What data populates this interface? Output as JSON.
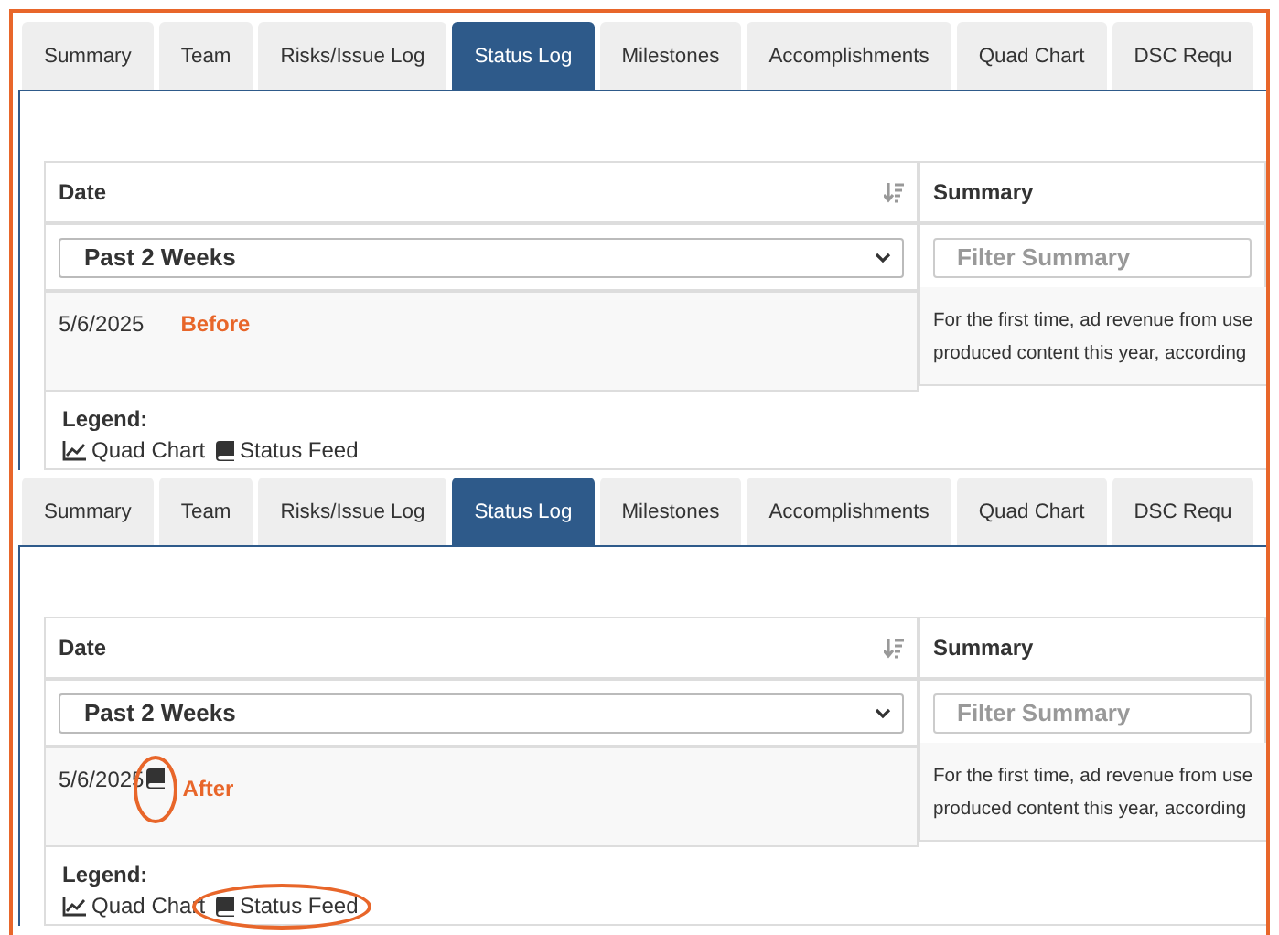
{
  "panels": [
    {
      "tabs": [
        {
          "label": "Summary",
          "selected": false
        },
        {
          "label": "Team",
          "selected": false
        },
        {
          "label": "Risks/Issue Log",
          "selected": false
        },
        {
          "label": "Status Log",
          "selected": true
        },
        {
          "label": "Milestones",
          "selected": false
        },
        {
          "label": "Accomplishments",
          "selected": false
        },
        {
          "label": "Quad Chart",
          "selected": false
        },
        {
          "label": "DSC Requ",
          "selected": false
        }
      ],
      "table": {
        "columns": [
          {
            "label": "Date",
            "sortable": true
          },
          {
            "label": "Summary",
            "sortable": false
          }
        ],
        "date_filter": "Past 2 Weeks",
        "summary_filter": {
          "placeholder": "Filter Summary"
        },
        "rows": [
          {
            "date": "5/6/2025",
            "status_feed_icon": false,
            "icon_circled": false,
            "summary_lines": [
              "For the first time, ad revenue from use",
              "produced content this year, according"
            ]
          }
        ]
      },
      "annotation": "Before",
      "legend": {
        "title": "Legend:",
        "items": [
          {
            "kind": "quad_chart",
            "label": "Quad Chart",
            "circled": false
          },
          {
            "kind": "status_feed",
            "label": "Status Feed",
            "circled": false
          }
        ]
      }
    },
    {
      "tabs": [
        {
          "label": "Summary",
          "selected": false
        },
        {
          "label": "Team",
          "selected": false
        },
        {
          "label": "Risks/Issue Log",
          "selected": false
        },
        {
          "label": "Status Log",
          "selected": true
        },
        {
          "label": "Milestones",
          "selected": false
        },
        {
          "label": "Accomplishments",
          "selected": false
        },
        {
          "label": "Quad Chart",
          "selected": false
        },
        {
          "label": "DSC Requ",
          "selected": false
        }
      ],
      "table": {
        "columns": [
          {
            "label": "Date",
            "sortable": true
          },
          {
            "label": "Summary",
            "sortable": false
          }
        ],
        "date_filter": "Past 2 Weeks",
        "summary_filter": {
          "placeholder": "Filter Summary"
        },
        "rows": [
          {
            "date": "5/6/2025",
            "status_feed_icon": true,
            "icon_circled": true,
            "summary_lines": [
              "For the first time, ad revenue from use",
              "produced content this year, according"
            ]
          }
        ]
      },
      "annotation": "After",
      "legend": {
        "title": "Legend:",
        "items": [
          {
            "kind": "quad_chart",
            "label": "Quad Chart",
            "circled": false
          },
          {
            "kind": "status_feed",
            "label": "Status Feed",
            "circled": true
          }
        ]
      }
    }
  ]
}
